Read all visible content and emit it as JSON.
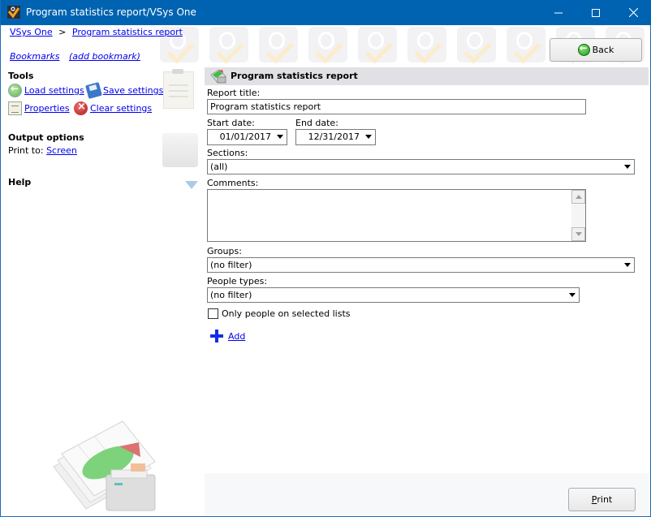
{
  "window": {
    "title": "Program statistics report/VSys One",
    "controls": [
      "minimize",
      "maximize",
      "close"
    ]
  },
  "header": {
    "breadcrumb": [
      {
        "label": "VSys One"
      },
      {
        "separator": ">"
      },
      {
        "label": "Program statistics report"
      }
    ],
    "bookmarks_label": "Bookmarks",
    "add_bookmark_label": "(add bookmark)",
    "back_label": "Back"
  },
  "sidebar": {
    "tools_heading": "Tools",
    "tools": [
      {
        "label": "Load settings",
        "icon": "load-settings-icon"
      },
      {
        "label": "Save settings",
        "icon": "save-settings-icon"
      },
      {
        "label": "Properties",
        "icon": "properties-icon"
      },
      {
        "label": "Clear settings",
        "icon": "clear-settings-icon"
      }
    ],
    "output_heading": "Output options",
    "print_to_label": "Print to:",
    "print_to_value": "Screen",
    "help_heading": "Help"
  },
  "form": {
    "title": "Program statistics report",
    "report_title_label": "Report title:",
    "report_title_value": "Program statistics report",
    "start_date_label": "Start date:",
    "start_date_value": "01/01/2017",
    "end_date_label": "End date:",
    "end_date_value": "12/31/2017",
    "sections_label": "Sections:",
    "sections_value": "(all)",
    "comments_label": "Comments:",
    "comments_value": "",
    "groups_label": "Groups:",
    "groups_value": "(no filter)",
    "people_types_label": "People types:",
    "people_types_value": "(no filter)",
    "only_selected_label": "Only people on selected lists",
    "only_selected_checked": false,
    "add_label": "Add"
  },
  "footer": {
    "print_label_accel": "P",
    "print_label_rest": "rint"
  }
}
